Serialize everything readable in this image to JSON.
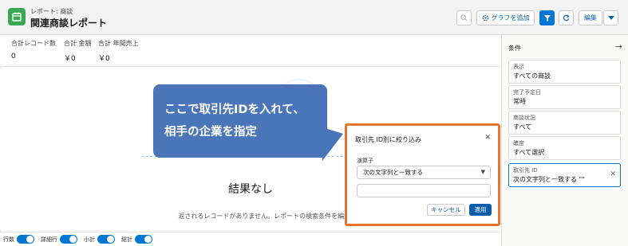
{
  "header": {
    "breadcrumb": "レポート: 商談",
    "title": "関連商談レポート",
    "add_graph_label": "グラフを追加",
    "edit_label": "編集"
  },
  "summary": [
    {
      "label": "合計レコード数",
      "value": "0"
    },
    {
      "label": "合計 金額",
      "value": "￥0"
    },
    {
      "label": "合計 年間売上",
      "value": "￥0"
    }
  ],
  "main": {
    "empty_title": "結果なし",
    "empty_desc": "返されるレコードがありません。レポートの検索条件を編集してください。"
  },
  "footer": {
    "toggles": [
      {
        "label": "行数",
        "on": true
      },
      {
        "label": "詳細行",
        "on": true
      },
      {
        "label": "小計",
        "on": true
      },
      {
        "label": "総計",
        "on": true
      }
    ]
  },
  "panel": {
    "title": "条件",
    "filters": [
      {
        "label": "表示",
        "value": "すべての商談"
      },
      {
        "label": "完了予定日",
        "value": "常時"
      },
      {
        "label": "商談状況",
        "value": "すべて"
      },
      {
        "label": "確度",
        "value": "すべて選択"
      },
      {
        "label": "取引先 ID",
        "value": "次の文字列と一致する \"\""
      }
    ]
  },
  "popover": {
    "title": "取引先 ID別に絞り込み",
    "operator_label": "演算子",
    "operator_value": "次の文字列と一致する",
    "input_value": "",
    "cancel_label": "キャンセル",
    "apply_label": "適用"
  },
  "callout": {
    "line1": "ここで取引先IDを入れて、",
    "line2": "相手の企業を指定"
  },
  "colors": {
    "brand": "#0176d3",
    "app_icon": "#3ba755",
    "highlight_border": "#e8742c",
    "callout": "#4a75b8"
  }
}
